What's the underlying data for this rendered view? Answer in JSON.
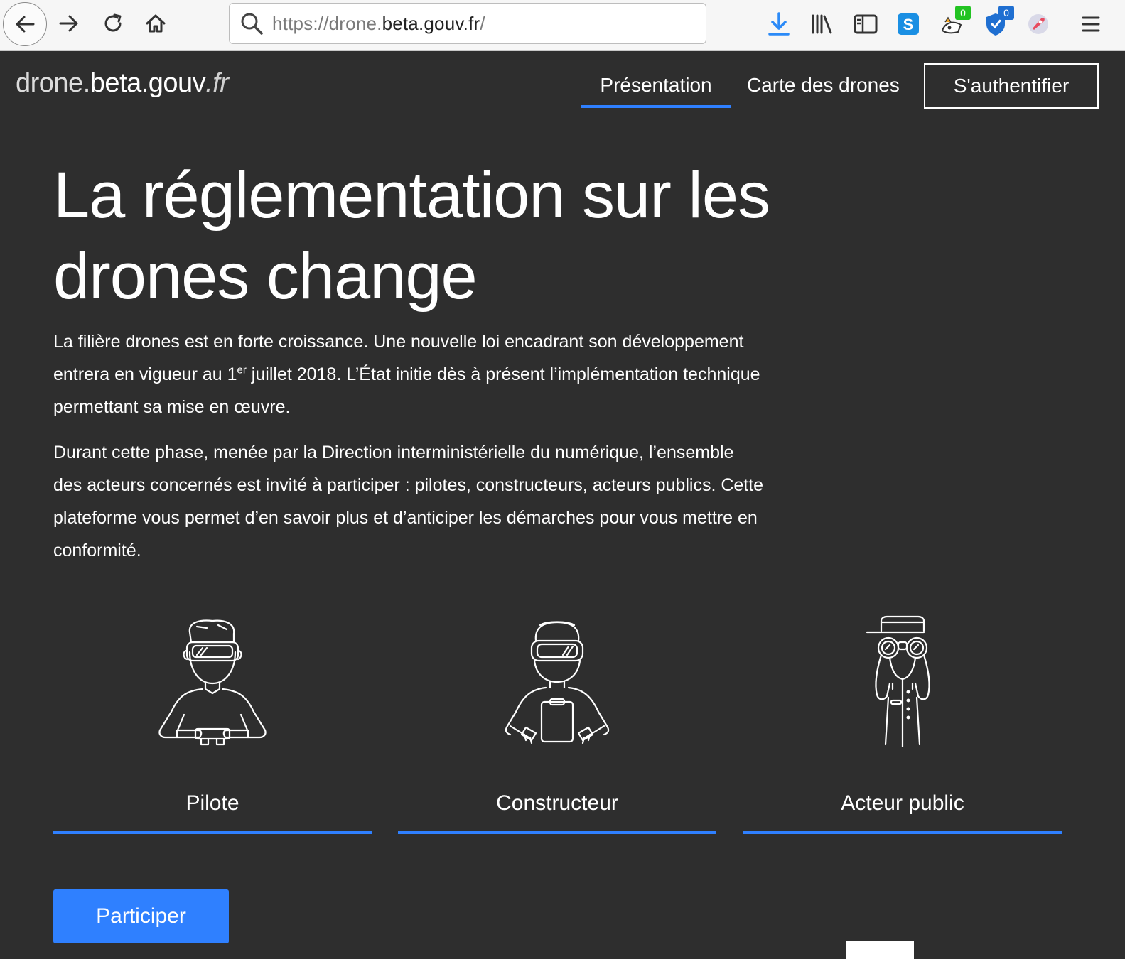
{
  "browser": {
    "url_prefix": "https://drone.",
    "url_host": "beta.gouv.fr",
    "url_suffix": "/",
    "ext_badge_green": "0",
    "ext_badge_blue": "0",
    "colors": {
      "toolbar": "#f6f6f6",
      "accent_blue": "#2b8af7"
    }
  },
  "header": {
    "logo_part1": "drone.",
    "logo_part2": "beta.gouv",
    "logo_part3": ".fr",
    "nav": {
      "presentation": "Présentation",
      "map": "Carte des drones",
      "login": "S'authentifier"
    }
  },
  "hero": {
    "title": "La réglementation sur les drones change",
    "p1_a": "La filière drones est en forte croissance. Une nouvelle loi encadrant son développement entrera en vigueur au 1",
    "p1_sup": "er",
    "p1_b": " juillet 2018. L’État initie dès à présent l’implémentation technique permettant sa mise en œuvre.",
    "p2": "Durant cette phase, menée par la Direction interministérielle du numérique, l’ensemble des acteurs concernés est invité à participer : pilotes, constructeurs, acteurs publics. Cette plateforme vous permet d’en savoir plus et d’anticiper les démarches pour vous mettre en conformité."
  },
  "roles": [
    {
      "label": "Pilote",
      "icon": "pilot-illustration"
    },
    {
      "label": "Constructeur",
      "icon": "constructor-illustration"
    },
    {
      "label": "Acteur public",
      "icon": "public-actor-illustration"
    }
  ],
  "cta": {
    "label": "Participer"
  },
  "colors": {
    "background": "#2e2e2e",
    "accent": "#2f80ff",
    "text": "#ffffff"
  }
}
